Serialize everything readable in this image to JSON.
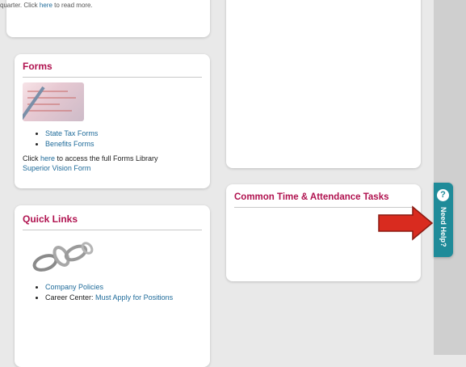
{
  "top_snippet": {
    "prefix": "quarter. Click ",
    "link": "here",
    "suffix": " to read more."
  },
  "forms_card": {
    "title": "Forms",
    "items": [
      "State Tax Forms",
      "Benefits Forms"
    ],
    "library_prefix": "Click ",
    "library_link": "here",
    "library_suffix": " to access the full Forms Library",
    "superior_vision": "Superior Vision Form"
  },
  "quick_links": {
    "title": "Quick Links",
    "company_policies": "Company Policies",
    "career_center_label": "Career Center:",
    "career_center_link": "Must Apply for Positions"
  },
  "common_tasks": {
    "title": "Common Time & Attendance Tasks"
  },
  "help_tab": {
    "icon_glyph": "?",
    "label": "Need Help?"
  },
  "colors": {
    "title_accent": "#b0124f",
    "link": "#1f6b9a",
    "help_tab": "#1f8b99",
    "arrow": "#d92b1f"
  }
}
